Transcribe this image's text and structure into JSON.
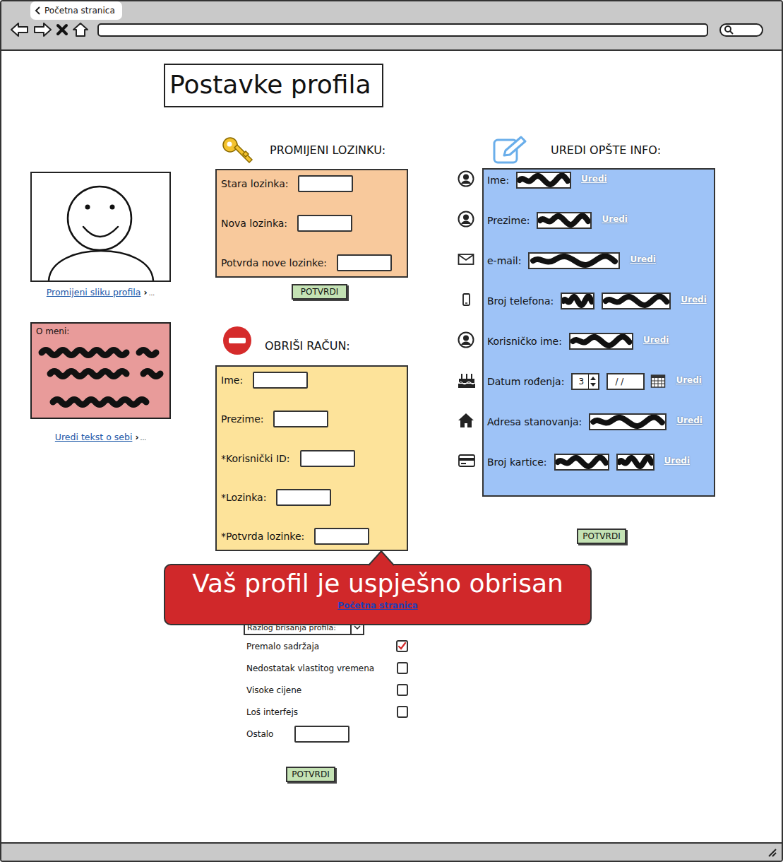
{
  "browser": {
    "tab": "Početna stranica"
  },
  "page": {
    "title": "Postavke profila"
  },
  "profile_picture": {
    "link": "Promijeni sliku profila",
    "chevron": "›",
    "ellipsis": "..."
  },
  "about": {
    "label": "O meni:",
    "redacted": true,
    "link": "Uredi tekst o sebi",
    "chevron": "›",
    "ellipsis": "..."
  },
  "change_password": {
    "heading": "PROMIJENI LOZINKU:",
    "fields": [
      {
        "label": "Stara lozinka:",
        "value": ""
      },
      {
        "label": "Nova lozinka:",
        "value": ""
      },
      {
        "label": "Potvrda nove lozinke:",
        "value": ""
      }
    ],
    "button": "POTVRDI"
  },
  "delete_account": {
    "heading": "OBRIŠI RAČUN:",
    "fields": [
      {
        "label": "Ime:",
        "value": ""
      },
      {
        "label": "Prezime:",
        "value": ""
      },
      {
        "label": "*Korisnički ID:",
        "value": ""
      },
      {
        "label": "*Lozinka:",
        "value": ""
      },
      {
        "label": "*Potvrda lozinke:",
        "value": ""
      }
    ],
    "reason_dropdown": {
      "label": "Razlog brisanja profila:"
    },
    "reasons": [
      {
        "label": "Premalo sadržaja",
        "checked": true
      },
      {
        "label": "Nedostatak vlastitog vremena",
        "checked": false
      },
      {
        "label": "Visoke cijene",
        "checked": false
      },
      {
        "label": "Loš interfejs",
        "checked": false
      }
    ],
    "other": {
      "label": "Ostalo",
      "value": ""
    },
    "button": "POTVRDI"
  },
  "general_info": {
    "heading": "UREDI OPŠTE INFO:",
    "rows": [
      {
        "label": "Ime:",
        "fields": [
          {
            "kind": "redacted"
          }
        ],
        "link": "Uredi"
      },
      {
        "label": "Prezime:",
        "fields": [
          {
            "kind": "redacted"
          }
        ],
        "link": "Uredi"
      },
      {
        "label": "e-mail:",
        "fields": [
          {
            "kind": "redacted"
          }
        ],
        "link": "Uredi"
      },
      {
        "label": "Broj telefona:",
        "fields": [
          {
            "kind": "redacted"
          },
          {
            "kind": "redacted"
          }
        ],
        "link": "Uredi"
      },
      {
        "label": "Korisničko ime:",
        "fields": [
          {
            "kind": "redacted"
          }
        ],
        "link": "Uredi"
      },
      {
        "label": "Datum rođenja:",
        "fields": [
          {
            "kind": "spinner",
            "value": "3"
          },
          {
            "kind": "date",
            "value": "/ /"
          }
        ],
        "link": "Uredi"
      },
      {
        "label": "Adresa stanovanja:",
        "fields": [
          {
            "kind": "redacted"
          }
        ],
        "link": "Uredi"
      },
      {
        "label": "Broj kartice:",
        "fields": [
          {
            "kind": "redacted"
          },
          {
            "kind": "redacted"
          }
        ],
        "link": "Uredi"
      }
    ],
    "button": "POTVRDI"
  },
  "toast": {
    "message": "Vaš profil je uspješno obrisan",
    "link": "Početna stranica"
  }
}
